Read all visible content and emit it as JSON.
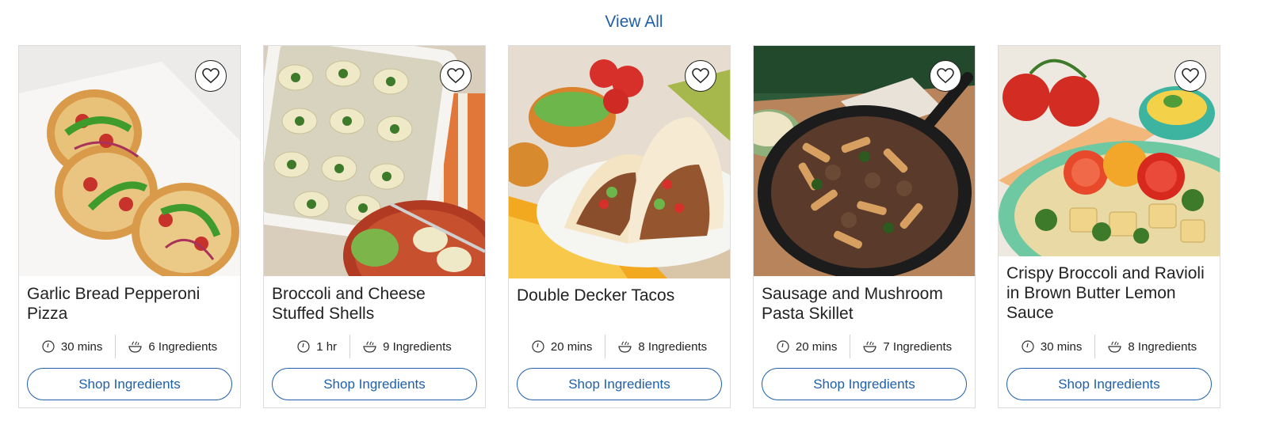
{
  "header": {
    "view_all": "View All"
  },
  "cards": [
    {
      "title": "Garlic Bread Pepperoni Pizza",
      "time": "30 mins",
      "ingredients": "6 Ingredients",
      "button": "Shop Ingredients"
    },
    {
      "title": "Broccoli and Cheese Stuffed Shells",
      "time": "1 hr",
      "ingredients": "9 Ingredients",
      "button": "Shop Ingredients"
    },
    {
      "title": "Double Decker Tacos",
      "time": "20 mins",
      "ingredients": "8 Ingredients",
      "button": "Shop Ingredients"
    },
    {
      "title": "Sausage and Mushroom Pasta Skillet",
      "time": "20 mins",
      "ingredients": "7 Ingredients",
      "button": "Shop Ingredients"
    },
    {
      "title": "Crispy Broccoli and Ravioli in Brown Butter Lemon Sauce",
      "time": "30 mins",
      "ingredients": "8 Ingredients",
      "button": "Shop Ingredients"
    }
  ],
  "colors": {
    "accent": "#1f5fa8",
    "border": "#dcdcdc",
    "text": "#222222"
  },
  "icons": {
    "favorite": "heart-icon",
    "time": "clock-icon",
    "ingredients": "bowl-icon"
  }
}
